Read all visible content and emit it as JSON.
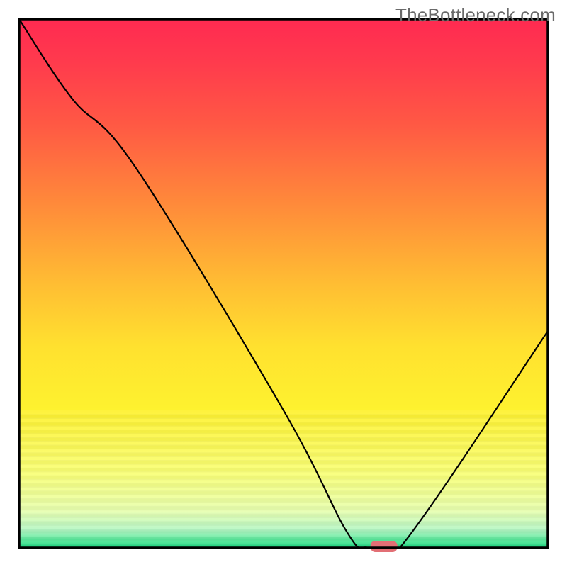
{
  "watermark": "TheBottleneck.com",
  "chart_data": {
    "type": "line",
    "title": "",
    "xlabel": "",
    "ylabel": "",
    "xlim": [
      0,
      100
    ],
    "ylim": [
      0,
      100
    ],
    "series": [
      {
        "name": "bottleneck-percentage",
        "x": [
          0,
          10,
          22,
          50,
          62,
          66,
          72,
          100
        ],
        "values": [
          100,
          85,
          72,
          26,
          3,
          0,
          0,
          41
        ]
      }
    ],
    "marker": {
      "name": "current-position",
      "x": 69,
      "y": 0,
      "color": "#e26f75"
    },
    "gradient_stops": [
      {
        "offset": 0.0,
        "color": "#ff2a51"
      },
      {
        "offset": 0.08,
        "color": "#ff3a4d"
      },
      {
        "offset": 0.2,
        "color": "#ff5944"
      },
      {
        "offset": 0.35,
        "color": "#ff8a3a"
      },
      {
        "offset": 0.5,
        "color": "#ffbd33"
      },
      {
        "offset": 0.62,
        "color": "#ffe12f"
      },
      {
        "offset": 0.74,
        "color": "#fef22f"
      },
      {
        "offset": 0.86,
        "color": "#f9ff78"
      },
      {
        "offset": 0.93,
        "color": "#e8ffb0"
      },
      {
        "offset": 0.965,
        "color": "#b7f7c4"
      },
      {
        "offset": 0.985,
        "color": "#57e89a"
      },
      {
        "offset": 1.0,
        "color": "#19d680"
      }
    ],
    "banding_region": {
      "from_y_frac": 0.74,
      "to_y_frac": 1.0,
      "bands": 36
    }
  }
}
